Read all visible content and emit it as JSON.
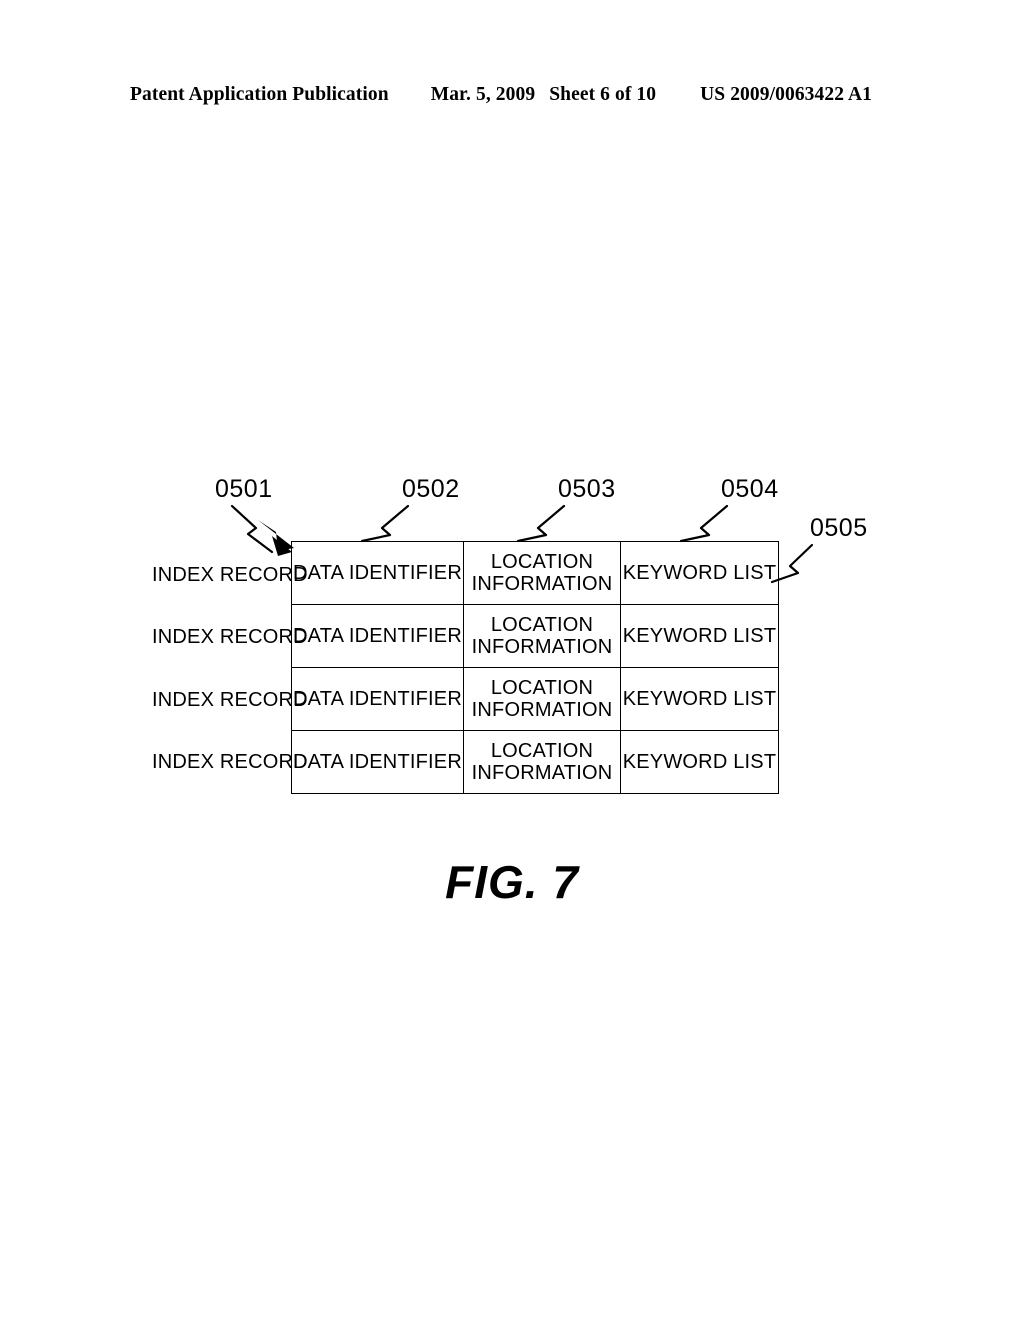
{
  "header": {
    "publication": "Patent Application Publication",
    "date": "Mar. 5, 2009",
    "sheet": "Sheet 6 of 10",
    "document_number": "US 2009/0063422 A1"
  },
  "figure": {
    "caption": "FIG. 7",
    "reference_numerals": [
      {
        "id": "0501",
        "label": "0501",
        "points_to": "index-record-table"
      },
      {
        "id": "0502",
        "label": "0502",
        "points_to": "data-identifier-column"
      },
      {
        "id": "0503",
        "label": "0503",
        "points_to": "location-information-column"
      },
      {
        "id": "0504",
        "label": "0504",
        "points_to": "keyword-list-column"
      },
      {
        "id": "0505",
        "label": "0505",
        "points_to": "index-record-row"
      }
    ],
    "row_labels": [
      "INDEX RECORD",
      "INDEX RECORD",
      "INDEX RECORD",
      "INDEX RECORD"
    ],
    "table": {
      "rows": [
        {
          "data_identifier": "DATA IDENTIFIER",
          "location_information_line1": "LOCATION",
          "location_information_line2": "INFORMATION",
          "keyword_list": "KEYWORD LIST"
        },
        {
          "data_identifier": "DATA IDENTIFIER",
          "location_information_line1": "LOCATION",
          "location_information_line2": "INFORMATION",
          "keyword_list": "KEYWORD LIST"
        },
        {
          "data_identifier": "DATA IDENTIFIER",
          "location_information_line1": "LOCATION",
          "location_information_line2": "INFORMATION",
          "keyword_list": "KEYWORD LIST"
        },
        {
          "data_identifier": "DATA IDENTIFIER",
          "location_information_line1": "LOCATION",
          "location_information_line2": "INFORMATION",
          "keyword_list": "KEYWORD LIST"
        }
      ]
    }
  },
  "colors": {
    "ink": "#000000",
    "page": "#ffffff"
  }
}
